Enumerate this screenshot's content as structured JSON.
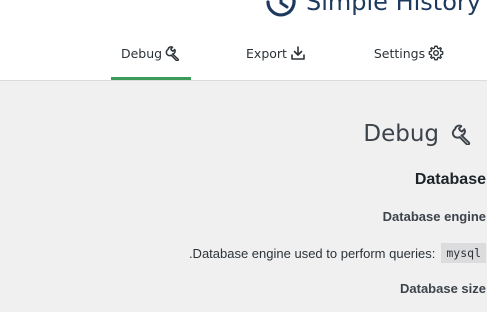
{
  "brand": {
    "name": "Simple History"
  },
  "tabs": [
    {
      "label": "Debug",
      "icon": "wrench-icon",
      "active": true
    },
    {
      "label": "Export",
      "icon": "download-icon",
      "active": false
    },
    {
      "label": "Settings",
      "icon": "gear-icon",
      "active": false
    }
  ],
  "content": {
    "title": "Debug",
    "title_icon": "wrench-icon",
    "section": "Database",
    "engine_heading": "Database engine",
    "engine_description": ".Database engine used to perform queries:",
    "engine_value": "mysql",
    "size_heading": "Database size"
  },
  "colors": {
    "accent_tab_bar": "#3c9a5b",
    "brand": "#1d3a5e",
    "background": "#f0f0f1"
  }
}
